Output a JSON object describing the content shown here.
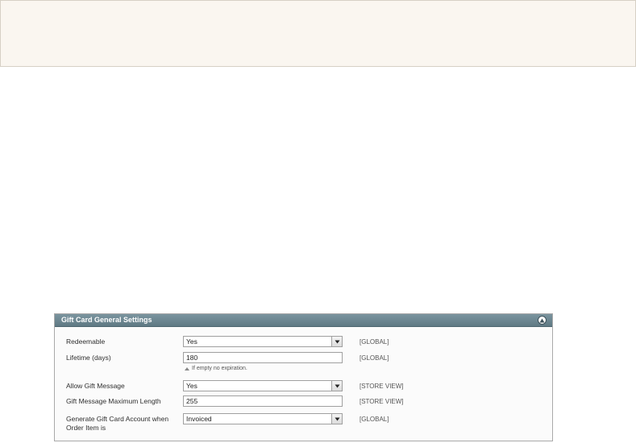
{
  "panel": {
    "title": "Gift Card General Settings",
    "fields": [
      {
        "label": "Redeemable",
        "value": "Yes",
        "type": "select",
        "scope": "[GLOBAL]"
      },
      {
        "label": "Lifetime (days)",
        "value": "180",
        "type": "text",
        "scope": "[GLOBAL]",
        "note": "If empty no expiration."
      },
      {
        "label": "Allow Gift Message",
        "value": "Yes",
        "type": "select",
        "scope": "[STORE VIEW]"
      },
      {
        "label": "Gift Message Maximum Length",
        "value": "255",
        "type": "text",
        "scope": "[STORE VIEW]"
      },
      {
        "label": "Generate Gift Card Account when Order Item is",
        "value": "Invoiced",
        "type": "select",
        "scope": "[GLOBAL]"
      }
    ]
  },
  "colors": {
    "header": "#6b8591",
    "banner": "#faf6f0"
  }
}
